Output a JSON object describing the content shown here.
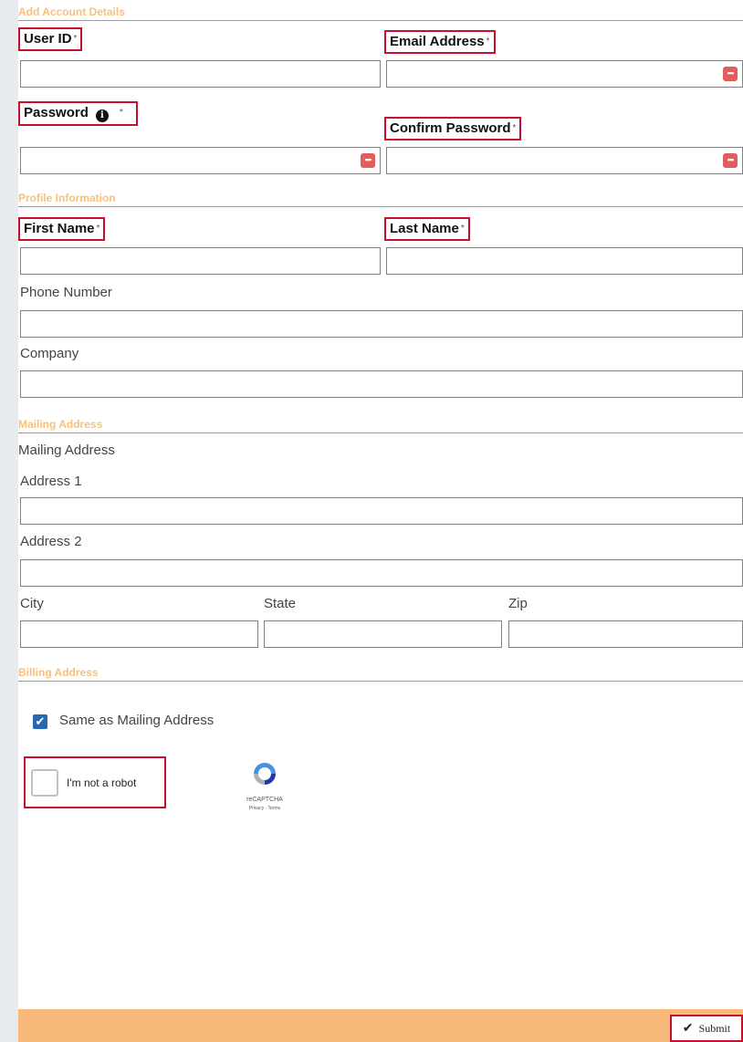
{
  "sections": {
    "account": "Add Account Details",
    "profile": "Profile Information",
    "mailing": "Mailing Address",
    "billing": "Billing Address"
  },
  "fields": {
    "user_id": "User ID",
    "email": "Email Address",
    "password": "Password",
    "confirm_password": "Confirm Password",
    "first_name": "First Name",
    "last_name": "Last Name",
    "phone": "Phone Number",
    "company": "Company",
    "mailing_subheading": "Mailing Address",
    "address1": "Address 1",
    "address2": "Address 2",
    "city": "City",
    "state": "State",
    "zip": "Zip"
  },
  "required_marker": "*",
  "billing": {
    "same_as_mailing": "Same as Mailing Address",
    "same_as_mailing_checked": true
  },
  "captcha": {
    "label": "I'm not a robot",
    "brand": "reCAPTCHA",
    "links": "Privacy - Terms"
  },
  "footer": {
    "submit_label": "Submit"
  },
  "colors": {
    "section_header": "#f9c07c",
    "required_outline": "#c8102e",
    "footer_bar": "#f9b97a",
    "checkbox": "#2a67b1",
    "password_icon": "#e35d5d"
  }
}
